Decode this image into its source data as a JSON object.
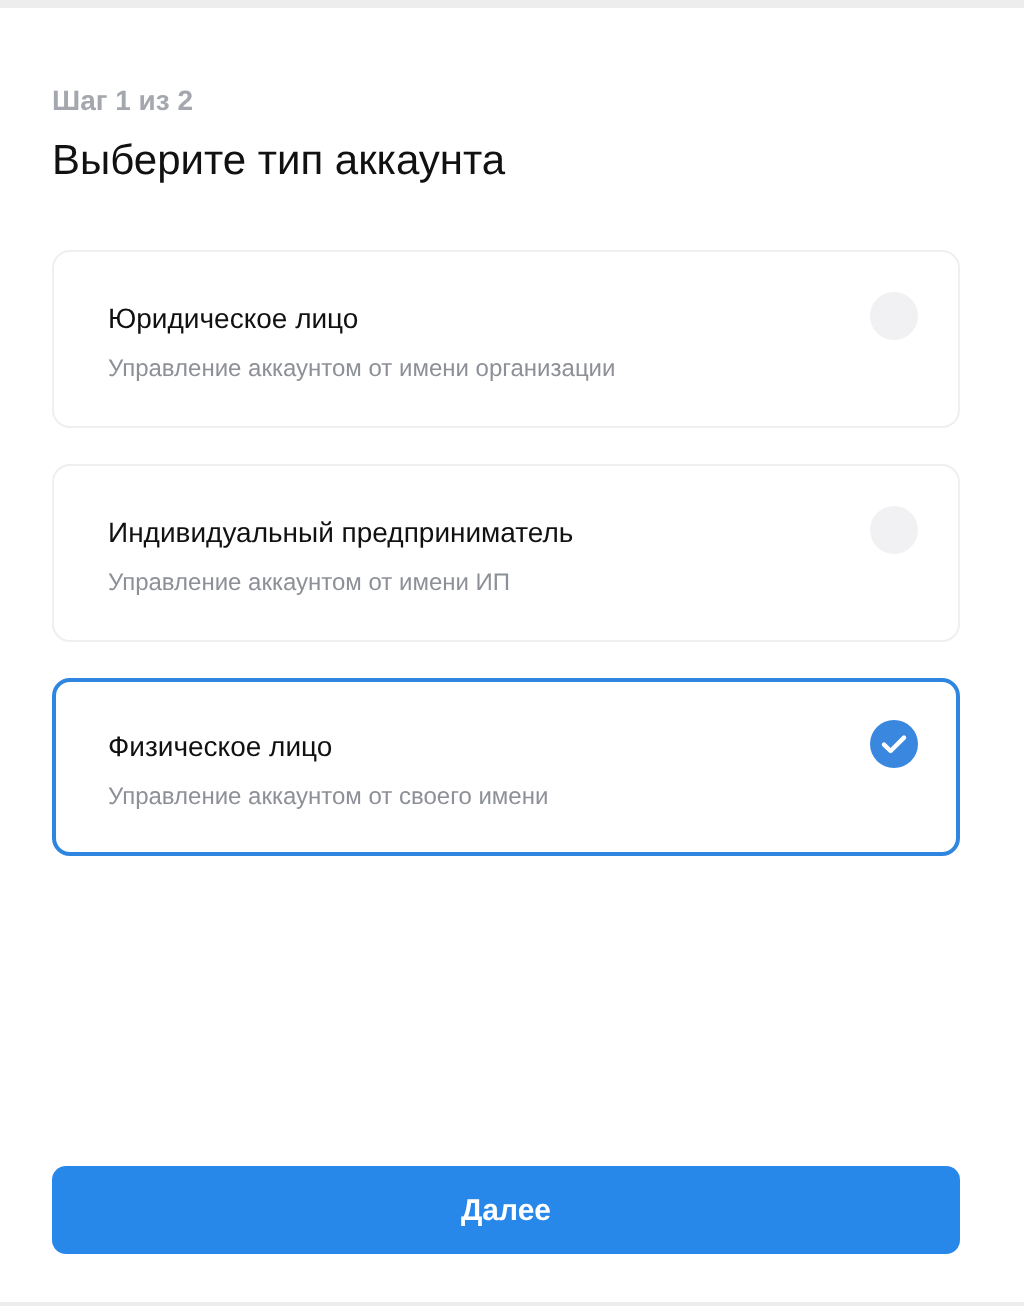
{
  "step": "Шаг 1 из 2",
  "title": "Выберите тип аккаунта",
  "options": [
    {
      "label": "Юридическое лицо",
      "description": "Управление аккаунтом от имени организации",
      "selected": false
    },
    {
      "label": "Индивидуальный предприниматель",
      "description": "Управление аккаунтом от имени ИП",
      "selected": false
    },
    {
      "label": "Физическое лицо",
      "description": "Управление аккаунтом от своего имени",
      "selected": true
    }
  ],
  "button": "Далее"
}
